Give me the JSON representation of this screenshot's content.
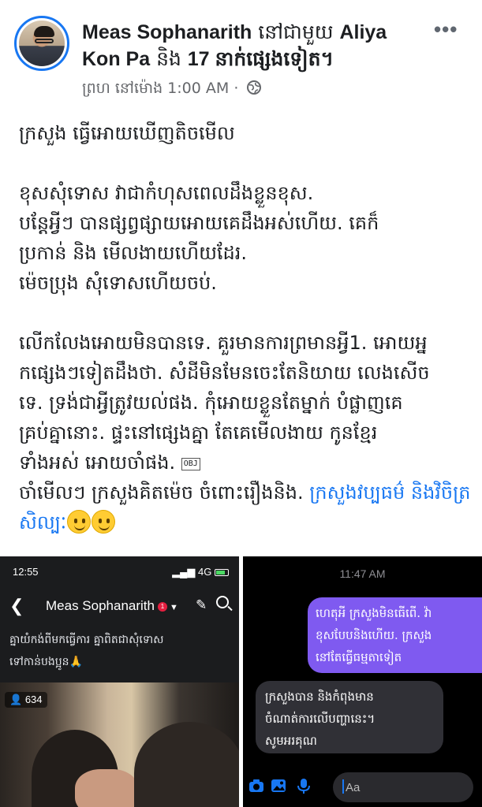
{
  "post": {
    "author": "Meas Sophanarith",
    "with_text": "នៅជាមួយ",
    "tagged_name": "Aliya Kon Pa",
    "and_text": "និង",
    "others": "17 នាក់ផ្សេងទៀត។",
    "time": "ព្រហ នៅម៉ោង 1:00 AM",
    "separator": "·",
    "more_label": "•••"
  },
  "body": {
    "line1": "ក្រសួង ធ្វើអោយឃើញតិចមើល",
    "para2_l1": "ខុសសុំទោស វាជាកំហុសពេលដឹងខ្លួនខុស.",
    "para2_l2": "បន្តែអ្វីៗ បានផ្សព្វផ្សាយអោយគេដឹងអស់ហើយ.   គេក៏",
    "para2_l3": "ប្រកាន់ និង មើលងាយហើយដែរ.",
    "para2_l4": "ម៉េចប្រុង សុំទោសហើយចប់.",
    "para3_l1": "លើកលែងអោយមិនបានទេ.  គួរមានការព្រមានអ្វី1. អោយអ្ន",
    "para3_l2": "កផ្សេងៗទៀតដឹងថា. សំដីមិនមែនចេះតែនិយាយ លេងសើច",
    "para3_l3": "ទេ.  ទ្រង់ជាអ្វីត្រូវយល់ផង.    កុំអោយខ្លួនតែម្នាក់ បំផ្លាញគេ",
    "para3_l4": "គ្រប់គ្នានោះ. ផ្ទះនៅផ្សេងគ្នា តែគេមើលងាយ កូនខ្មែរ",
    "para3_l5": "ទាំងអស់ អោយចាំផង.",
    "obj_marker": "OBJ",
    "para4_text": "ចាំមើលៗ ក្រសួងគិតម៉េច ចំពោះរឿងនិង.",
    "para4_link": "ក្រសួងវប្បធម៌ និងវិចិត្រសិល្បៈ"
  },
  "left_shot": {
    "status_time": "12:55",
    "status_net": "4G",
    "page_name": "Meas Sophanarith",
    "notif_count": "1",
    "caption_l1": "គ្នាយំកង់ពីមកធ្វើការ គ្នាពិតជាសុំទោស",
    "caption_l2": "ទៅកាន់បងប្អូន🙏",
    "views": "634"
  },
  "right_shot": {
    "time": "11:47 AM",
    "outgoing_l1": "ហេតុអី ក្រសួងមិនធើពើ. វ៉ា",
    "outgoing_l2": "ខុសបែបនិងហើយ. ក្រសួង",
    "outgoing_l3": "នៅតែធ្វើធម្មតាទៀត",
    "incoming_l1": "ក្រសួងបាន និងកំពុងមាន",
    "incoming_l2": "ចំណាត់ការលើបញ្ហានេះ។",
    "incoming_l3": "សូមអរគុណ",
    "input_placeholder": "Aa"
  },
  "colors": {
    "link": "#1877f2",
    "outgoing_bubble": "#7f5af0",
    "incoming_bubble": "#303036"
  }
}
